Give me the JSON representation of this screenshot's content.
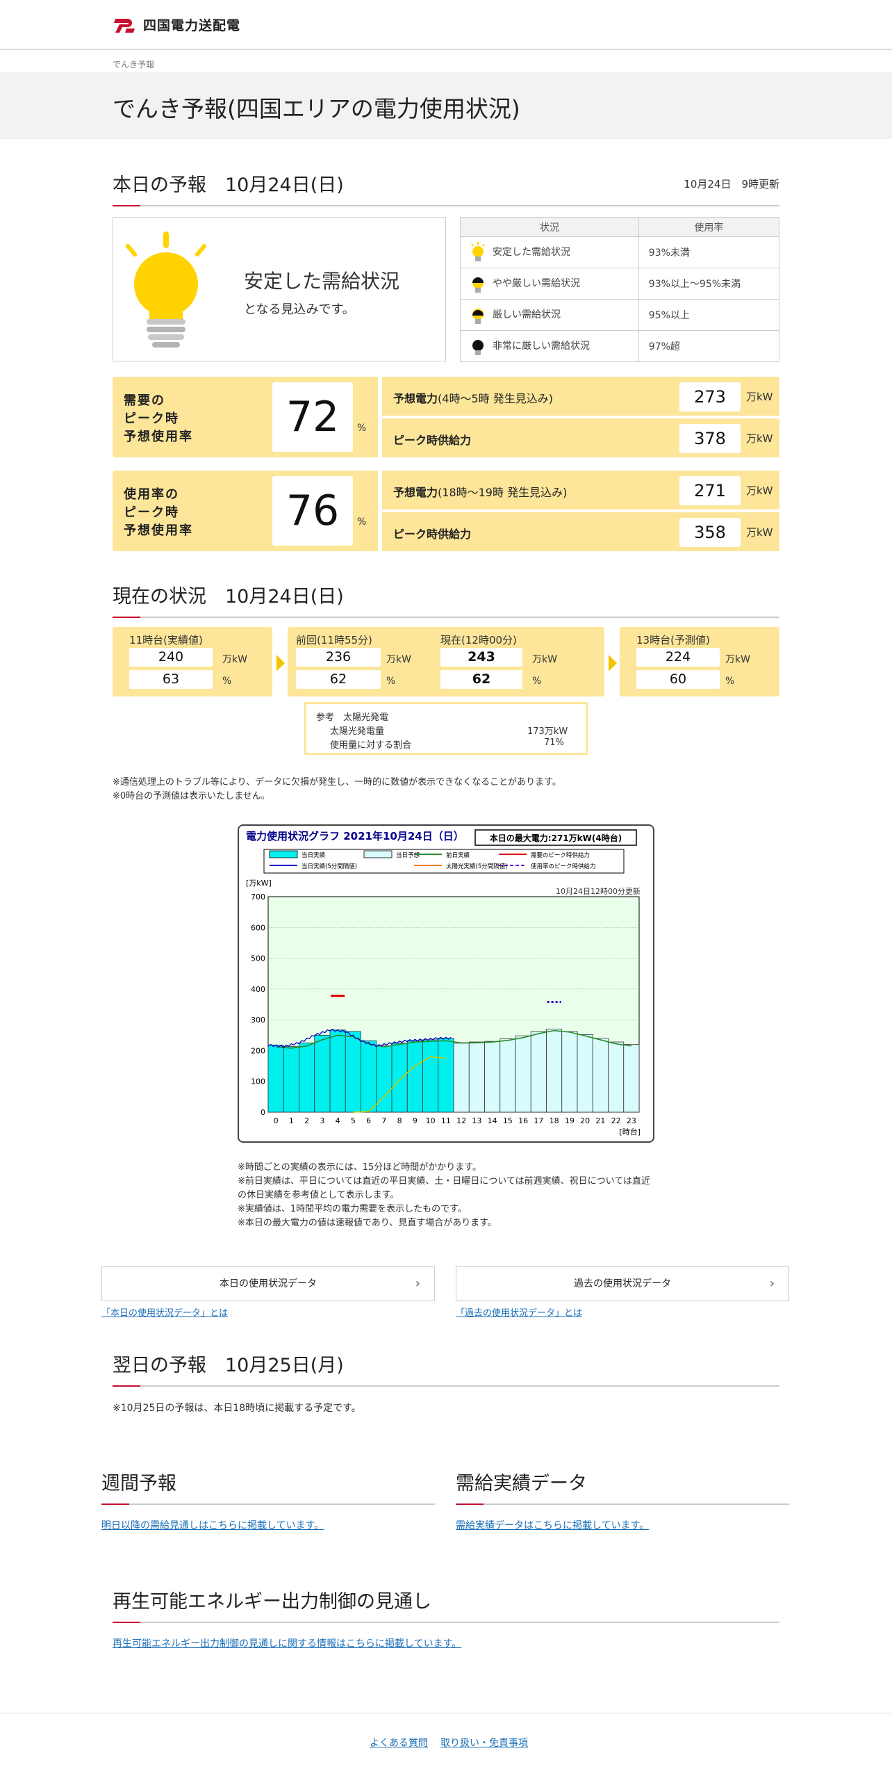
{
  "header": {
    "logo_text": "四国電力送配電"
  },
  "breadcrumb": "でんき予報",
  "page_title": "でんき予報(四国エリアの電力使用状況)",
  "today": {
    "heading": "本日の予報　10月24日(日)",
    "updated": "10月24日　9時更新",
    "status_main": "安定した需給状況",
    "status_sub": "となる見込みです。",
    "legend_headers": [
      "状況",
      "使用率"
    ],
    "legend_rows": [
      {
        "status": "安定した需給状況",
        "rate": "93%未満",
        "color": "#ffd200"
      },
      {
        "status": "やや厳しい需給状況",
        "rate": "93%以上～95%未満",
        "color": "#ffd200"
      },
      {
        "status": "厳しい需給状況",
        "rate": "95%以上",
        "color": "#ffd200"
      },
      {
        "status": "非常に厳しい需給状況",
        "rate": "97%超",
        "color": "#000000"
      }
    ],
    "forecast1": {
      "label": "需要の\nピーク時\n予想使用率",
      "value": "72",
      "pct": "%",
      "demand_label": "予想電力",
      "demand_note": "(4時～5時 発生見込み)",
      "demand_value": "273",
      "supply_label": "ピーク時供給力",
      "supply_value": "378",
      "unit": "万kW"
    },
    "forecast2": {
      "label": "使用率の\nピーク時\n予想使用率",
      "value": "76",
      "pct": "%",
      "demand_label": "予想電力",
      "demand_note": "(18時～19時 発生見込み)",
      "demand_value": "271",
      "supply_label": "ピーク時供給力",
      "supply_value": "358",
      "unit": "万kW"
    }
  },
  "current": {
    "heading": "現在の状況　10月24日(日)",
    "unit_kw": "万kW",
    "unit_pct": "%",
    "p11": {
      "title": "11時台(実績値)",
      "kw": "240",
      "pct": "63"
    },
    "prev": {
      "title": "前回(11時55分)",
      "kw": "236",
      "pct": "62"
    },
    "now": {
      "title": "現在(12時00分)",
      "kw": "243",
      "pct": "62"
    },
    "p13": {
      "title": "13時台(予測値)",
      "kw": "224",
      "pct": "60"
    },
    "solar": {
      "title": "参考　太陽光発電",
      "gen_label": "太陽光発電量",
      "gen_value": "173万kW",
      "ratio_label": "使用量に対する割合",
      "ratio_value": "71%"
    },
    "notes": [
      "※通信処理上のトラブル等により、データに欠損が発生し、一時的に数値が表示できなくなることがあります。",
      "※0時台の予測値は表示いたしません。"
    ]
  },
  "chart_data": {
    "type": "bar",
    "title": "電力使用状況グラフ 2021年10月24日（日）",
    "max_label": "本日の最大電力:271万kW(4時台)",
    "update_label": "10月24日12時00分更新",
    "ylabel": "[万kW]",
    "xlabel": "[時台]",
    "ylim": [
      0,
      700
    ],
    "yticks": [
      0,
      100,
      200,
      300,
      400,
      500,
      600,
      700
    ],
    "categories": [
      "0",
      "1",
      "2",
      "3",
      "4",
      "5",
      "6",
      "7",
      "8",
      "9",
      "10",
      "11",
      "12",
      "13",
      "14",
      "15",
      "16",
      "17",
      "18",
      "19",
      "20",
      "21",
      "22",
      "23"
    ],
    "legend": [
      {
        "name": "当日実績",
        "color": "#00f0f0",
        "kind": "box"
      },
      {
        "name": "当日予想",
        "color": "#d8fbfb",
        "kind": "box"
      },
      {
        "name": "前日実績",
        "color": "#2e8b2e",
        "kind": "line"
      },
      {
        "name": "需要のピーク時供給力",
        "color": "#e00000",
        "kind": "line"
      },
      {
        "name": "当日実績(5分間隔値)",
        "color": "#0000cc",
        "kind": "line"
      },
      {
        "name": "太陽光実績(5分間隔値)",
        "color": "#f08020",
        "kind": "line"
      },
      {
        "name": "使用率のピーク時供給力",
        "color": "#6a00cc",
        "kind": "dash"
      }
    ],
    "series": [
      {
        "name": "当日実績",
        "values": [
          218,
          213,
          225,
          250,
          267,
          262,
          232,
          215,
          224,
          232,
          235,
          240
        ]
      },
      {
        "name": "当日予想",
        "values": [
          null,
          null,
          null,
          null,
          null,
          null,
          null,
          null,
          null,
          null,
          null,
          null,
          224,
          228,
          230,
          238,
          248,
          262,
          270,
          262,
          252,
          240,
          228,
          220
        ]
      },
      {
        "name": "前日実績",
        "values": [
          212,
          208,
          215,
          235,
          250,
          245,
          222,
          212,
          220,
          228,
          230,
          232,
          225,
          225,
          228,
          233,
          242,
          255,
          265,
          260,
          248,
          235,
          222,
          215
        ]
      },
      {
        "name": "太陽光実績(5分間隔値)",
        "values": [
          0,
          0,
          0,
          0,
          0,
          0,
          2,
          50,
          105,
          150,
          180,
          175
        ]
      }
    ],
    "supply_peak_demand": {
      "hour": 4,
      "value": 378
    },
    "supply_peak_usage": {
      "hour": 18,
      "value": 358
    }
  },
  "chart_notes": [
    "※時間ごとの実績の表示には、15分ほど時間がかかります。",
    "※前日実績は、平日については直近の平日実績、土・日曜日については前週実績、祝日については直近",
    "の休日実績を参考値として表示します。",
    "※実績値は、1時間平均の電力需要を表示したものです。",
    "※本日の最大電力の値は速報値であり、見直す場合があります。"
  ],
  "buttons": {
    "today_data": "本日の使用状況データ",
    "past_data": "過去の使用状況データ",
    "today_link": "「本日の使用状況データ」とは",
    "past_link": "「過去の使用状況データ」とは"
  },
  "tomorrow": {
    "heading": "翌日の予報　10月25日(月)",
    "note": "※10月25日の予報は、本日18時頃に掲載する予定です。"
  },
  "weekly": {
    "heading": "週間予報",
    "link": "明日以降の需給見通しはこちらに掲載しています。"
  },
  "supply_data": {
    "heading": "需給実績データ",
    "link": "需給実績データはこちらに掲載しています。"
  },
  "renewable": {
    "heading": "再生可能エネルギー出力制御の見通し",
    "link": "再生可能エネルギー出力制御の見通しに関する情報はこちらに掲載しています。"
  },
  "footer": {
    "faq": "よくある質問",
    "disclaimer": "取り扱い・免責事項"
  }
}
